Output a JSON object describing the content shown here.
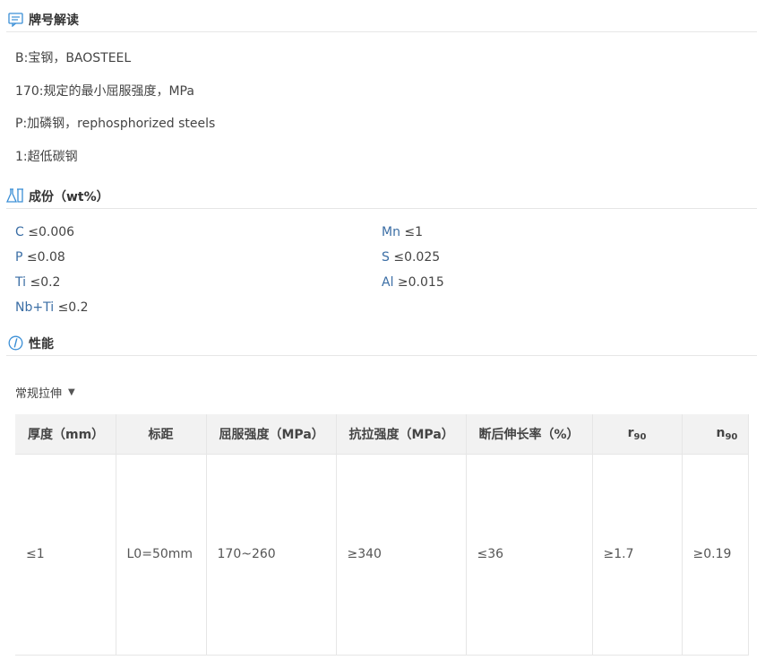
{
  "sections": {
    "grade": {
      "title": "牌号解读",
      "icon": "message-icon"
    },
    "composition": {
      "title": "成份（wt%）",
      "icon": "flask-icon"
    },
    "performance": {
      "title": "性能",
      "icon": "info-icon"
    }
  },
  "grade_lines": [
    "B:宝钢，BAOSTEEL",
    "170:规定的最小屈服强度，MPa",
    "P:加磷钢，rephosphorized steels",
    "1:超低碳钢"
  ],
  "composition": [
    {
      "element": "C",
      "value": "≤0.006"
    },
    {
      "element": "Mn",
      "value": "≤1"
    },
    {
      "element": "P",
      "value": "≤0.08"
    },
    {
      "element": "S",
      "value": "≤0.025"
    },
    {
      "element": "Ti",
      "value": "≤0.2"
    },
    {
      "element": "Al",
      "value": "≥0.015"
    },
    {
      "element": "Nb+Ti",
      "value": " ≤0.2"
    }
  ],
  "performance": {
    "dropdown_label": "常规拉伸",
    "columns": {
      "thickness": "厚度（mm）",
      "gauge": "标距",
      "yield": "屈服强度（MPa）",
      "tensile": "抗拉强度（MPa）",
      "elongation": "断后伸长率（%）",
      "r90_base": "r",
      "r90_sub": "90",
      "n90_base": "n",
      "n90_sub": "90"
    },
    "row": {
      "thickness": "≤1",
      "gauge": "L0=50mm",
      "yield": "170~260",
      "tensile": "≥340",
      "elongation": "≤36",
      "r90": "≥1.7",
      "n90": "≥0.19"
    }
  }
}
